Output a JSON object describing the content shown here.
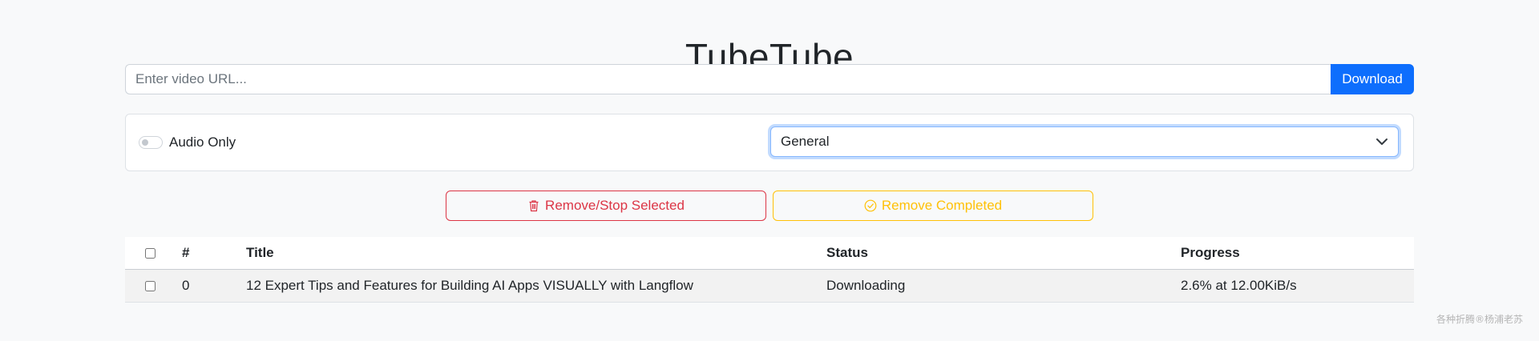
{
  "app": {
    "title": "TubeTube"
  },
  "url_bar": {
    "placeholder": "Enter video URL...",
    "value": "",
    "download_label": "Download"
  },
  "options": {
    "audio_only_label": "Audio Only",
    "audio_only_checked": false,
    "quality_selected": "General"
  },
  "actions": {
    "remove_stop_label": "Remove/Stop Selected",
    "remove_completed_label": "Remove Completed"
  },
  "table": {
    "headers": {
      "num": "#",
      "title": "Title",
      "status": "Status",
      "progress": "Progress"
    },
    "rows": [
      {
        "num": "0",
        "title": "12 Expert Tips and Features for Building AI Apps VISUALLY with Langflow",
        "status": "Downloading",
        "progress": "2.6% at 12.00KiB/s"
      }
    ]
  },
  "watermark": "各种折腾®杨浦老苏",
  "colors": {
    "primary": "#0d6efd",
    "danger": "#dc3545",
    "warning": "#ffc107",
    "background": "#f8f9fa"
  },
  "icons": {
    "remove_stop": "trash-icon",
    "remove_completed": "check-circle-icon",
    "select": "chevron-down-icon"
  }
}
